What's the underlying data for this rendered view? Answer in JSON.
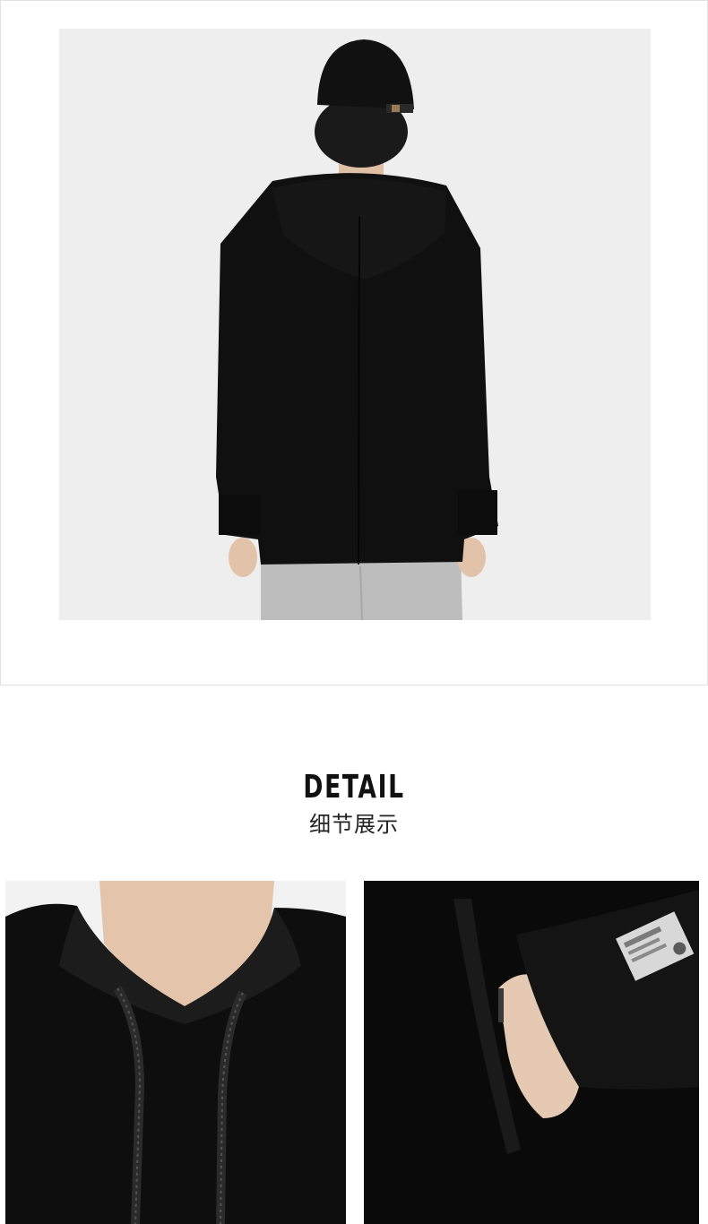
{
  "main_photo": {
    "subject": "model-back-view-black-hoodie-grey-pants"
  },
  "detail_section": {
    "title_en": "DETAIL",
    "title_cn": "细节展示"
  },
  "detail_photos": [
    {
      "subject": "hood-neckline-drawstrings"
    },
    {
      "subject": "kangaroo-pocket-hand-and-sleeve-label"
    }
  ]
}
